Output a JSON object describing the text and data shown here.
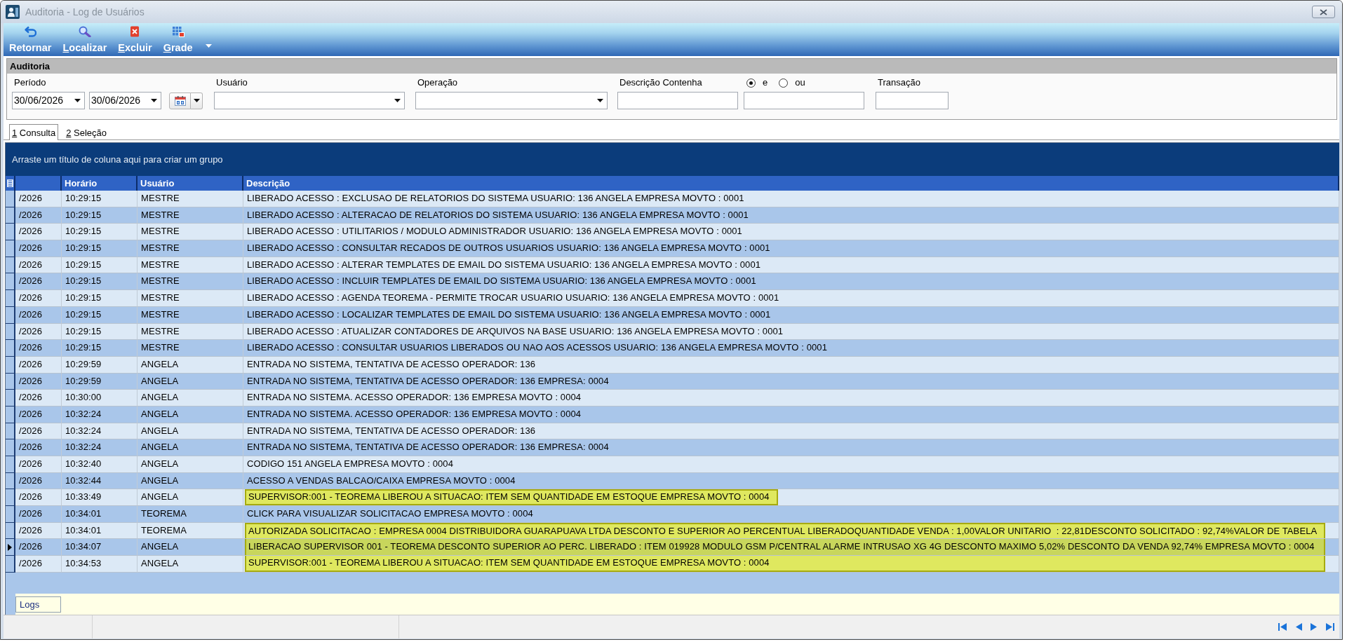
{
  "window": {
    "title": "Auditoria - Log de Usuários"
  },
  "toolbar": {
    "buttons": [
      {
        "label": "Retornar",
        "mnemonic": false
      },
      {
        "label": "Localizar",
        "mnemonic": true
      },
      {
        "label": "Excluir",
        "mnemonic": true
      },
      {
        "label": "Grade",
        "mnemonic": true
      }
    ]
  },
  "filter_panel": {
    "title": "Auditoria",
    "period": {
      "label": "Período",
      "from": "30/06/2026",
      "to": "30/06/2026"
    },
    "user": {
      "label": "Usuário"
    },
    "operation": {
      "label": "Operação"
    },
    "description": {
      "label": "Descrição Contenha",
      "options": [
        {
          "label": "e",
          "selected": true
        },
        {
          "label": "ou",
          "selected": false
        }
      ]
    },
    "transaction": {
      "label": "Transação"
    }
  },
  "tabs": [
    {
      "label": "1 Consulta",
      "selected": true,
      "mnemonic": true
    },
    {
      "label": "2 Seleção",
      "selected": false,
      "mnemonic": true
    }
  ],
  "grid": {
    "group_hint": "Arraste um título de coluna aqui para criar um grupo",
    "columns": [
      "Horário",
      "Usuário",
      "Descrição"
    ],
    "rows": [
      {
        "column_1": "/2026",
        "time": "10:29:15",
        "user": "MESTRE",
        "description": "LIBERADO ACESSO : EXCLUSAO DE RELATORIOS DO SISTEMA USUARIO: 136 ANGELA EMPRESA MOVTO : 0001",
        "selected": false,
        "highlighted": false
      },
      {
        "column_1": "/2026",
        "time": "10:29:15",
        "user": "MESTRE",
        "description": "LIBERADO ACESSO : ALTERACAO DE RELATORIOS DO SISTEMA USUARIO: 136 ANGELA EMPRESA MOVTO : 0001",
        "selected": false,
        "highlighted": false
      },
      {
        "column_1": "/2026",
        "time": "10:29:15",
        "user": "MESTRE",
        "description": "LIBERADO ACESSO : UTILITARIOS / MODULO ADMINISTRADOR USUARIO: 136 ANGELA EMPRESA MOVTO : 0001",
        "selected": false,
        "highlighted": false
      },
      {
        "column_1": "/2026",
        "time": "10:29:15",
        "user": "MESTRE",
        "description": "LIBERADO ACESSO : CONSULTAR RECADOS DE OUTROS USUARIOS USUARIO: 136 ANGELA EMPRESA MOVTO : 0001",
        "selected": false,
        "highlighted": false
      },
      {
        "column_1": "/2026",
        "time": "10:29:15",
        "user": "MESTRE",
        "description": "LIBERADO ACESSO : ALTERAR TEMPLATES DE EMAIL DO SISTEMA USUARIO: 136 ANGELA EMPRESA MOVTO : 0001",
        "selected": false,
        "highlighted": false
      },
      {
        "column_1": "/2026",
        "time": "10:29:15",
        "user": "MESTRE",
        "description": "LIBERADO ACESSO : INCLUIR TEMPLATES DE EMAIL DO SISTEMA USUARIO: 136 ANGELA EMPRESA MOVTO : 0001",
        "selected": false,
        "highlighted": false
      },
      {
        "column_1": "/2026",
        "time": "10:29:15",
        "user": "MESTRE",
        "description": "LIBERADO ACESSO : AGENDA TEOREMA - PERMITE TROCAR USUARIO USUARIO: 136 ANGELA EMPRESA MOVTO : 0001",
        "selected": false,
        "highlighted": false
      },
      {
        "column_1": "/2026",
        "time": "10:29:15",
        "user": "MESTRE",
        "description": "LIBERADO ACESSO : LOCALIZAR TEMPLATES DE EMAIL DO SISTEMA USUARIO: 136 ANGELA EMPRESA MOVTO : 0001",
        "selected": false,
        "highlighted": false
      },
      {
        "column_1": "/2026",
        "time": "10:29:15",
        "user": "MESTRE",
        "description": "LIBERADO ACESSO : ATUALIZAR CONTADORES DE ARQUIVOS NA BASE USUARIO: 136 ANGELA EMPRESA MOVTO : 0001",
        "selected": false,
        "highlighted": false
      },
      {
        "column_1": "/2026",
        "time": "10:29:15",
        "user": "MESTRE",
        "description": "LIBERADO ACESSO : CONSULTAR USUARIOS LIBERADOS OU NAO AOS ACESSOS USUARIO: 136 ANGELA EMPRESA MOVTO : 0001",
        "selected": false,
        "highlighted": false
      },
      {
        "column_1": "/2026",
        "time": "10:29:59",
        "user": "ANGELA",
        "description": "ENTRADA NO SISTEMA, TENTATIVA DE ACESSO OPERADOR: 136",
        "selected": false,
        "highlighted": false
      },
      {
        "column_1": "/2026",
        "time": "10:29:59",
        "user": "ANGELA",
        "description": "ENTRADA NO SISTEMA, TENTATIVA DE ACESSO OPERADOR: 136 EMPRESA: 0004",
        "selected": false,
        "highlighted": false
      },
      {
        "column_1": "/2026",
        "time": "10:30:00",
        "user": "ANGELA",
        "description": "ENTRADA NO SISTEMA. ACESSO OPERADOR: 136 EMPRESA MOVTO : 0004",
        "selected": false,
        "highlighted": false
      },
      {
        "column_1": "/2026",
        "time": "10:32:24",
        "user": "ANGELA",
        "description": "ENTRADA NO SISTEMA. ACESSO OPERADOR: 136 EMPRESA MOVTO : 0004",
        "selected": false,
        "highlighted": false
      },
      {
        "column_1": "/2026",
        "time": "10:32:24",
        "user": "ANGELA",
        "description": "ENTRADA NO SISTEMA, TENTATIVA DE ACESSO OPERADOR: 136",
        "selected": false,
        "highlighted": false
      },
      {
        "column_1": "/2026",
        "time": "10:32:24",
        "user": "ANGELA",
        "description": "ENTRADA NO SISTEMA, TENTATIVA DE ACESSO OPERADOR: 136 EMPRESA: 0004",
        "selected": false,
        "highlighted": false
      },
      {
        "column_1": "/2026",
        "time": "10:32:40",
        "user": "ANGELA",
        "description": "CODIGO 151 ANGELA EMPRESA MOVTO : 0004",
        "selected": false,
        "highlighted": false
      },
      {
        "column_1": "/2026",
        "time": "10:32:44",
        "user": "ANGELA",
        "description": "ACESSO A VENDAS BALCAO/CAIXA EMPRESA MOVTO : 0004",
        "selected": false,
        "highlighted": false
      },
      {
        "column_1": "/2026",
        "time": "10:33:49",
        "user": "ANGELA",
        "description": "SUPERVISOR:001 - TEOREMA LIBEROU A SITUACAO: ITEM SEM QUANTIDADE EM ESTOQUE EMPRESA MOVTO : 0004",
        "selected": false,
        "highlighted": true
      },
      {
        "column_1": "/2026",
        "time": "10:34:01",
        "user": "TEOREMA",
        "description": "CLICK PARA VISUALIZAR SOLICITACAO EMPRESA MOVTO : 0004",
        "selected": false,
        "highlighted": false
      },
      {
        "column_1": "/2026",
        "time": "10:34:01",
        "user": "TEOREMA",
        "description": "AUTORIZADA SOLICITACAO : EMPRESA 0004 DISTRIBUIDORA GUARAPUAVA LTDA DESCONTO E SUPERIOR AO PERCENTUAL LIBERADOQUANTIDADE VENDA : 1,00VALOR UNITARIO  : 22,81DESCONTO SOLICITADO : 92,74%VALOR DE TABELA",
        "selected": false,
        "highlighted": true
      },
      {
        "column_1": "/2026",
        "time": "10:34:07",
        "user": "ANGELA",
        "description": "LIBERACAO SUPERVISOR 001 - TEOREMA DESCONTO SUPERIOR AO PERC. LIBERADO : ITEM 019928 MODULO GSM P/CENTRAL ALARME INTRUSAO XG 4G DESCONTO MAXIMO 5,02% DESCONTO DA VENDA 92,74% EMPRESA MOVTO : 0004",
        "selected": true,
        "highlighted": true
      },
      {
        "column_1": "/2026",
        "time": "10:34:53",
        "user": "ANGELA",
        "description": "SUPERVISOR:001 - TEOREMA LIBEROU A SITUACAO: ITEM SEM QUANTIDADE EM ESTOQUE EMPRESA MOVTO : 0004",
        "selected": false,
        "highlighted": true
      }
    ],
    "summary": "Logs"
  }
}
